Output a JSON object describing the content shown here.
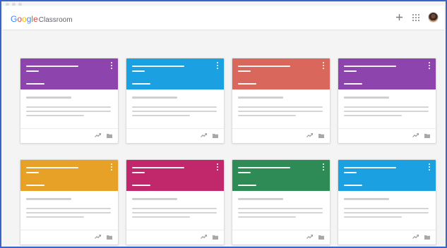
{
  "app": {
    "brand_letters": [
      "G",
      "o",
      "o",
      "g",
      "l",
      "e"
    ],
    "product": "Classroom"
  },
  "toolbar": {
    "add_icon": "plus-icon",
    "apps_icon": "apps-grid-icon",
    "account_icon": "avatar"
  },
  "colors": {
    "frame_border": "#3a64c8",
    "purple": "#8e44ad",
    "blue": "#1ba1e2",
    "coral": "#d9675b",
    "orange": "#e8a127",
    "magenta": "#c0286b",
    "green": "#2f8b55"
  },
  "cards": [
    {
      "color": "#8e44ad"
    },
    {
      "color": "#1ba1e2"
    },
    {
      "color": "#d9675b"
    },
    {
      "color": "#8e44ad"
    },
    {
      "color": "#e8a127"
    },
    {
      "color": "#c0286b"
    },
    {
      "color": "#2f8b55"
    },
    {
      "color": "#1ba1e2"
    }
  ]
}
